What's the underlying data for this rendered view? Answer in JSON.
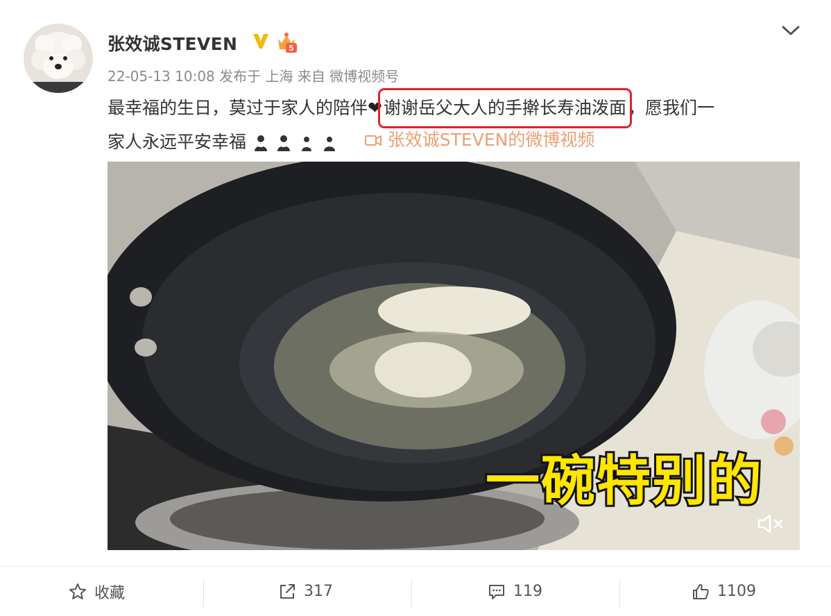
{
  "user": {
    "name": "张效诚STEVEN",
    "verified_badge": "V",
    "level_badge": "5"
  },
  "meta": {
    "datetime": "22-05-13 10:08",
    "posted_in": "发布于 上海",
    "source": "来自 微博视频号"
  },
  "post": {
    "line1_before": "最幸福的生日，莫过于家人的陪伴",
    "heart": "❤",
    "line1_highlight": "谢谢岳父大人的手擀长寿油泼面",
    "line1_after": "，愿我们一",
    "line2_text": "家人永远平安幸福",
    "emoji_icons": [
      "person-icon",
      "person-icon",
      "person-icon",
      "person-icon"
    ],
    "video_link_label": "张效诚STEVEN的微博视频"
  },
  "video": {
    "subtitle": "一碗特别的"
  },
  "actions": {
    "favorite_label": "收藏",
    "share_count": "317",
    "comment_count": "119",
    "like_count": "1109"
  },
  "colors": {
    "highlight_box": "#e0232b",
    "video_link": "#e8a074",
    "meta_text": "#8a8a8a",
    "subtitle_fill": "#ffe600",
    "verified_badge": "#f5b800"
  }
}
